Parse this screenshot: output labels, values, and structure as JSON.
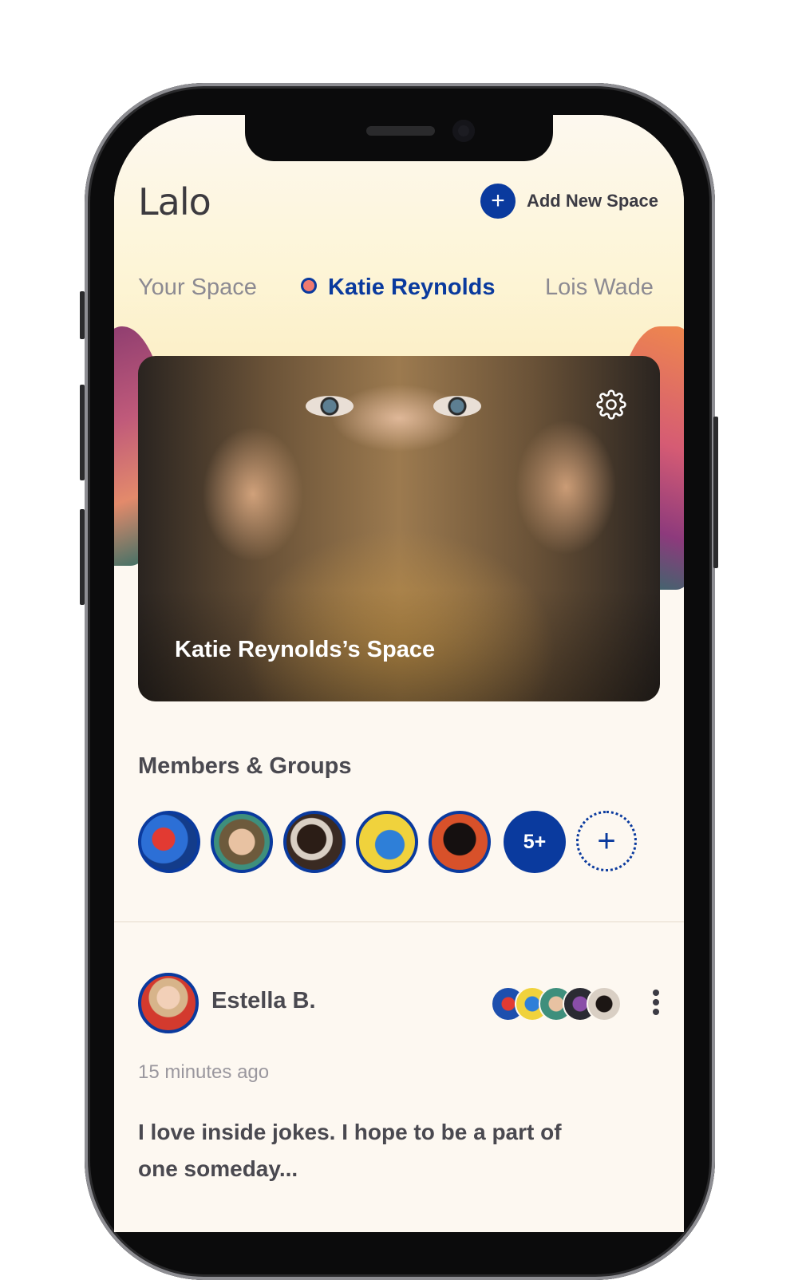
{
  "app": {
    "logo": "Lalo"
  },
  "header": {
    "add_space_label": "Add New Space",
    "add_icon": "plus-icon"
  },
  "tabs": [
    {
      "label": "Your Space",
      "active": false
    },
    {
      "label": "Katie Reynolds",
      "active": true
    },
    {
      "label": "Lois Wade",
      "active": false
    }
  ],
  "hero": {
    "title": "Katie Reynolds’s Space",
    "settings_icon": "gear-icon"
  },
  "members": {
    "title": "Members & Groups",
    "more_label": "5+",
    "add_icon": "plus-icon"
  },
  "post": {
    "author": "Estella B.",
    "time": "15 minutes ago",
    "text": "I love inside jokes. I hope to be a part of one someday...",
    "menu_icon": "more-vertical-icon"
  },
  "colors": {
    "accent": "#0a3a9e",
    "background": "#fdf8f1",
    "dot": "#ef7a6f"
  }
}
